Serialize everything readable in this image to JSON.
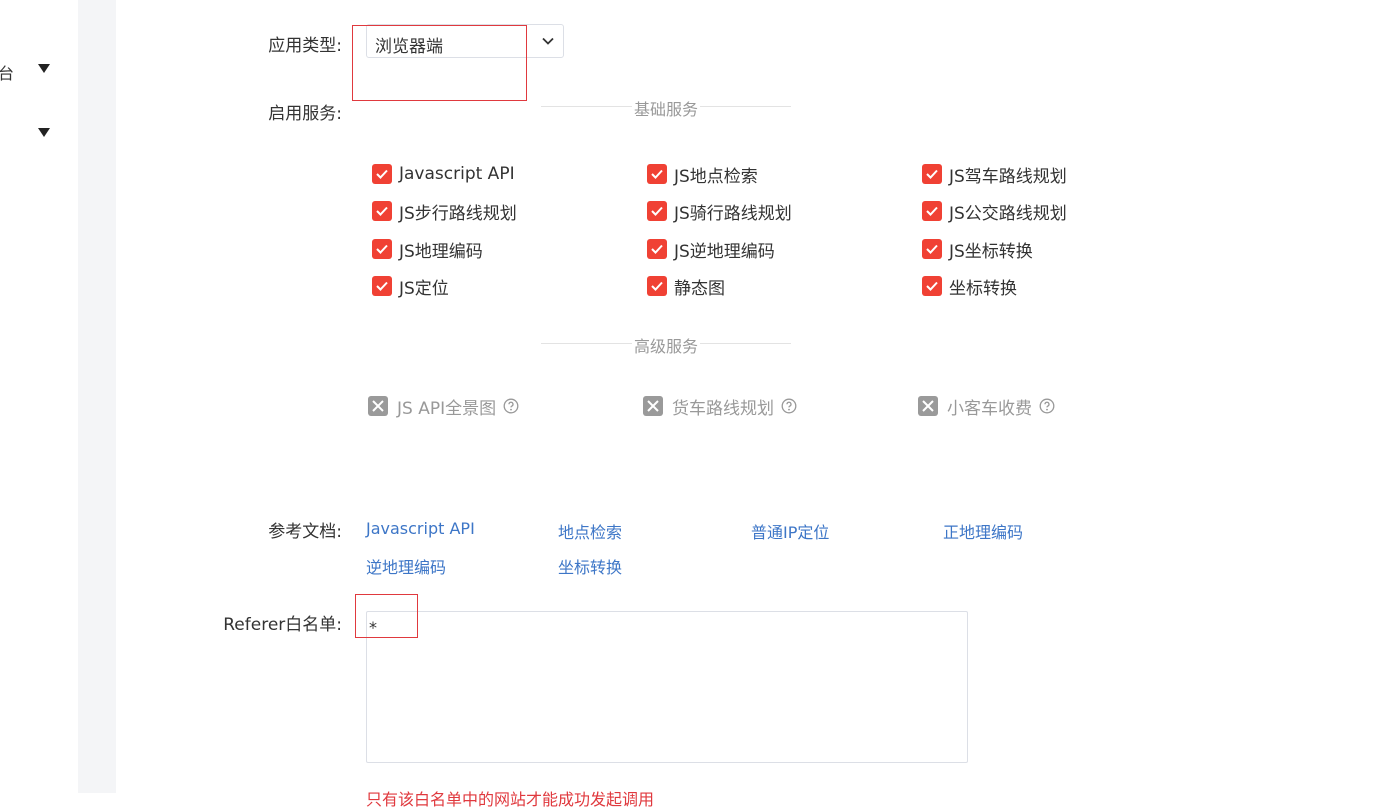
{
  "sidebar": {
    "items": [
      {
        "label": "台"
      },
      {
        "label": ""
      }
    ]
  },
  "form": {
    "app_type": {
      "label": "应用类型:",
      "value": "浏览器端"
    },
    "services_label": "启用服务:",
    "basic_title": "基础服务",
    "basic_services": [
      {
        "label": "Javascript API",
        "checked": true
      },
      {
        "label": "JS地点检索",
        "checked": true
      },
      {
        "label": "JS驾车路线规划",
        "checked": true
      },
      {
        "label": "JS步行路线规划",
        "checked": true
      },
      {
        "label": "JS骑行路线规划",
        "checked": true
      },
      {
        "label": "JS公交路线规划",
        "checked": true
      },
      {
        "label": "JS地理编码",
        "checked": true
      },
      {
        "label": "JS逆地理编码",
        "checked": true
      },
      {
        "label": "JS坐标转换",
        "checked": true
      },
      {
        "label": "JS定位",
        "checked": true
      },
      {
        "label": "静态图",
        "checked": true
      },
      {
        "label": "坐标转换",
        "checked": true
      }
    ],
    "advanced_title": "高级服务",
    "advanced_services": [
      {
        "label": "JS API全景图"
      },
      {
        "label": "货车路线规划"
      },
      {
        "label": "小客车收费"
      }
    ],
    "docs_label": "参考文档:",
    "docs": [
      {
        "label": "Javascript API"
      },
      {
        "label": "地点检索"
      },
      {
        "label": "普通IP定位"
      },
      {
        "label": "正地理编码"
      },
      {
        "label": "逆地理编码"
      },
      {
        "label": "坐标转换"
      }
    ],
    "referer": {
      "label": "Referer白名单:",
      "value": "*"
    },
    "hint": "只有该白名单中的网站才能成功发起调用"
  },
  "colors": {
    "checkbox_checked": "#f04134",
    "highlight_box": "#e0393e",
    "link": "#3d76c7",
    "disabled": "#9a9a9a"
  }
}
